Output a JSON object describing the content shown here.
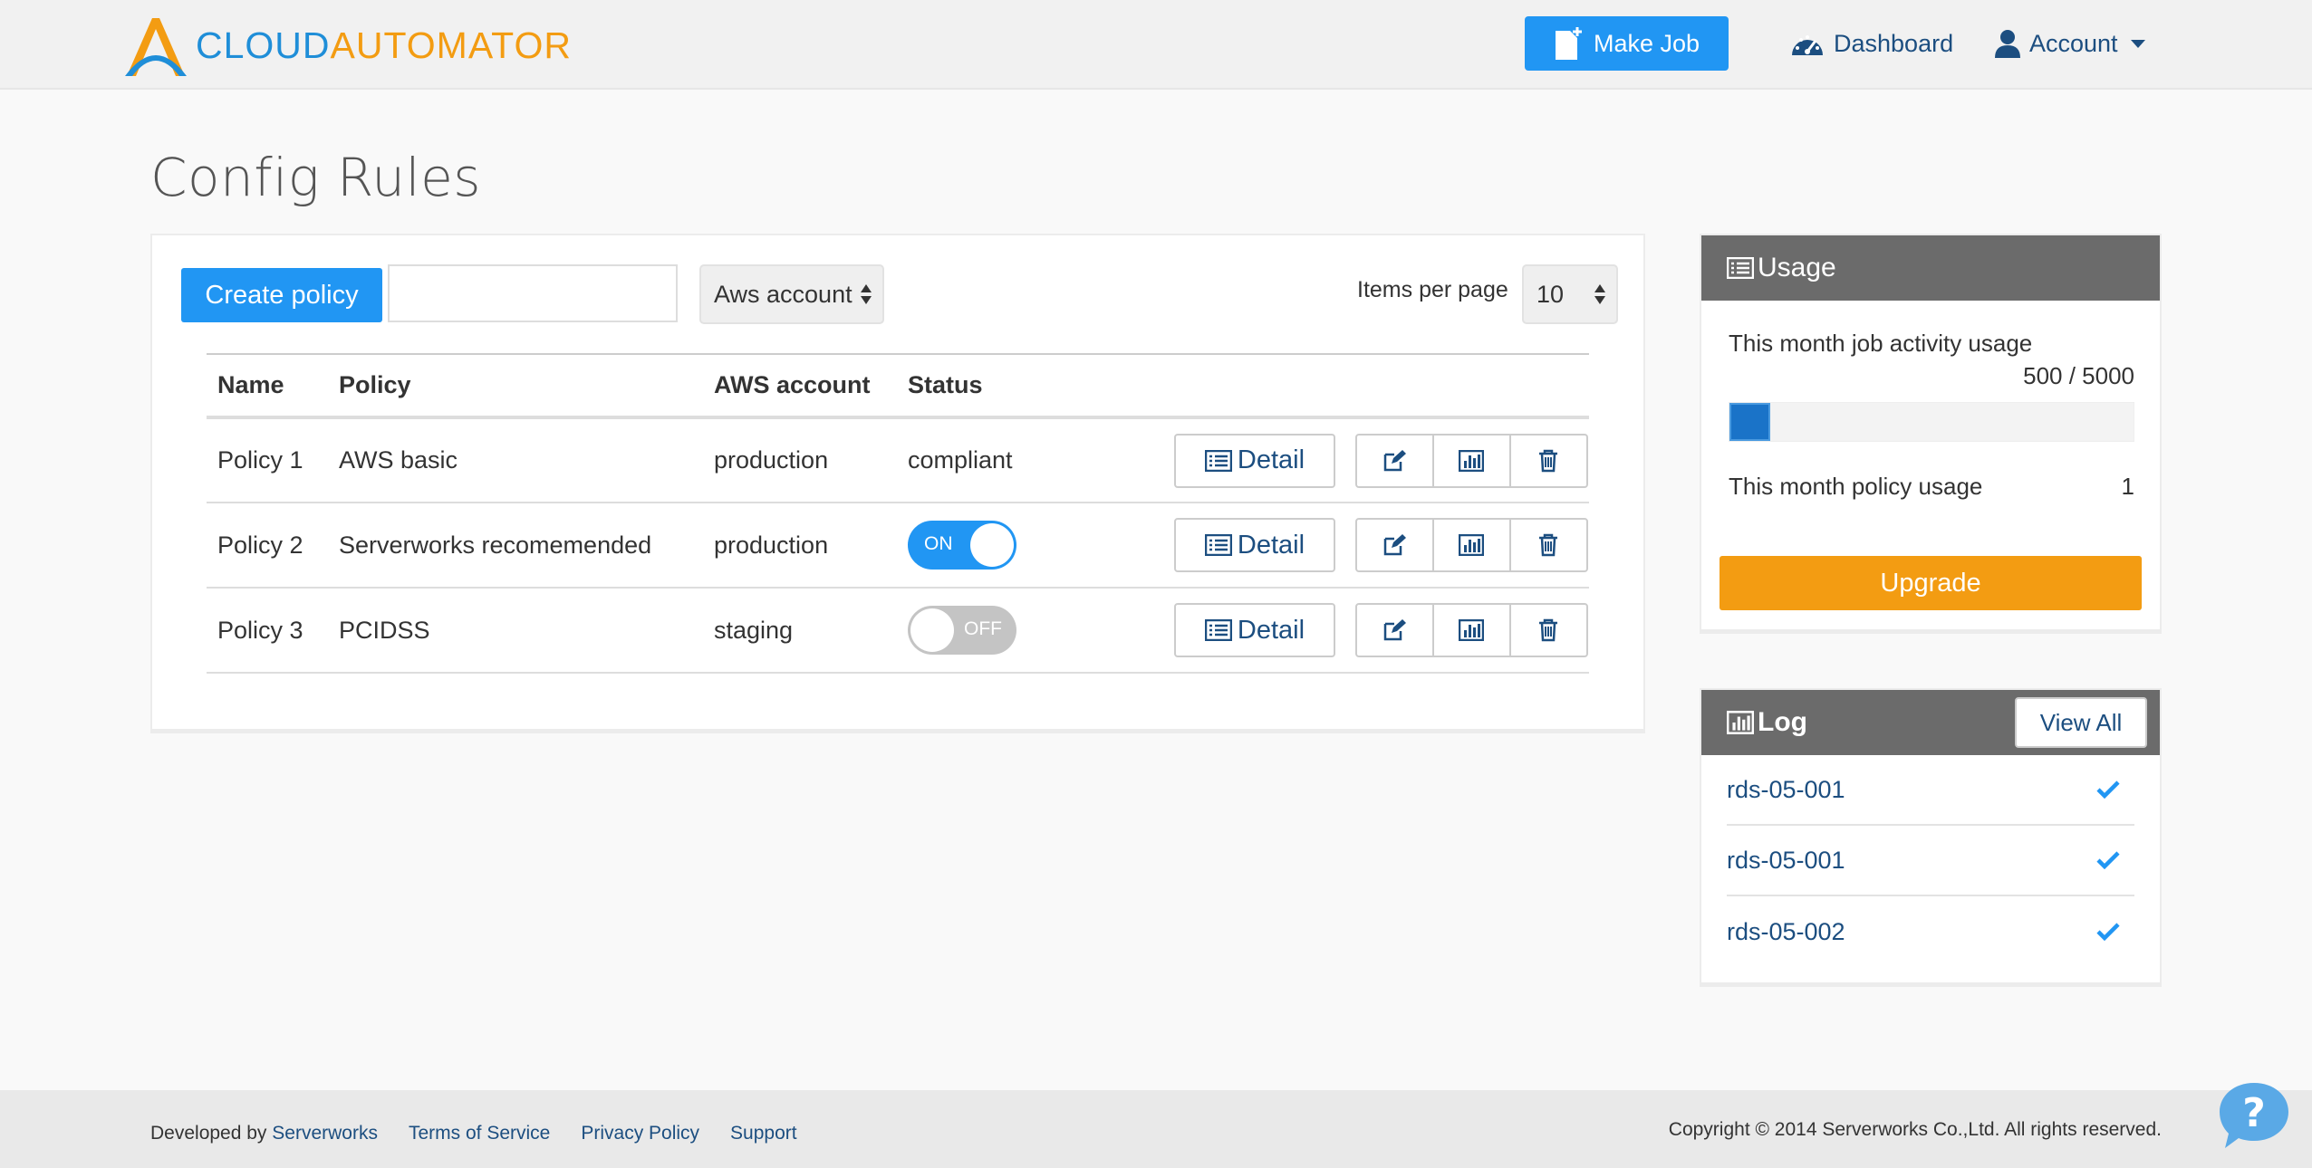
{
  "header": {
    "logo_cloud": "CLOUD",
    "logo_automator": "AUTOMATOR",
    "make_job": "Make Job",
    "dashboard": "Dashboard",
    "account": "Account"
  },
  "page": {
    "title": "Config Rules"
  },
  "toolbar": {
    "create_policy": "Create policy",
    "search_value": "",
    "aws_account_select": "Aws account",
    "items_per_page_label": "Items per page",
    "items_per_page_value": "10"
  },
  "table": {
    "headers": [
      "Name",
      "Policy",
      "AWS account",
      "Status"
    ],
    "detail_label": "Detail",
    "rows": [
      {
        "name": "Policy 1",
        "policy": "AWS basic",
        "aws_account": "production",
        "status": "compliant",
        "status_type": "text"
      },
      {
        "name": "Policy 2",
        "policy": "Serverworks recomemended",
        "aws_account": "production",
        "status": "ON",
        "status_type": "toggle-on"
      },
      {
        "name": "Policy 3",
        "policy": "PCIDSS",
        "aws_account": "staging",
        "status": "OFF",
        "status_type": "toggle-off"
      }
    ]
  },
  "usage": {
    "title": "Usage",
    "job_activity_label": "This month job activity usage",
    "job_activity_value": "500 / 5000",
    "job_activity_fraction": 0.1,
    "policy_usage_label": "This month policy usage",
    "policy_usage_value": "1",
    "upgrade": "Upgrade"
  },
  "log": {
    "title": "Log",
    "view_all": "View All",
    "items": [
      "rds-05-001",
      "rds-05-001",
      "rds-05-002"
    ]
  },
  "footer": {
    "developed_by": "Developed by",
    "serverworks": "Serverworks",
    "terms": "Terms of Service",
    "privacy": "Privacy Policy",
    "support": "Support",
    "copyright": "Copyright © 2014 Serverworks Co.,Ltd. All rights reserved."
  },
  "colors": {
    "accent_blue": "#2196f3",
    "orange": "#f39c12",
    "link": "#1c4e80",
    "panel_header": "#6b6b6b"
  }
}
